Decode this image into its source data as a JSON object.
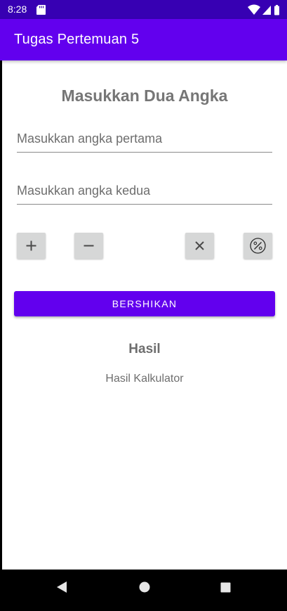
{
  "status_bar": {
    "time": "8:28",
    "icons": [
      "sd-card-icon",
      "wifi-icon",
      "signal-icon",
      "battery-icon"
    ]
  },
  "app_bar": {
    "title": "Tugas Pertemuan 5"
  },
  "form": {
    "heading": "Masukkan Dua Angka",
    "first_number_placeholder": "Masukkan angka pertama",
    "first_number_value": "",
    "second_number_placeholder": "Masukkan angka kedua",
    "second_number_value": ""
  },
  "operations": [
    {
      "name": "add",
      "icon": "plus-icon"
    },
    {
      "name": "subtract",
      "icon": "minus-icon"
    },
    {
      "name": "multiply",
      "icon": "multiply-icon"
    },
    {
      "name": "divide",
      "icon": "percent-icon"
    }
  ],
  "clear_button": {
    "label": "BERSHIKAN"
  },
  "result": {
    "title": "Hasil",
    "value": "Hasil Kalkulator"
  },
  "nav_bar": {
    "icons": [
      "back-icon",
      "home-icon",
      "recents-icon"
    ]
  },
  "colors": {
    "status_bar": "#3700b3",
    "app_bar": "#6200ee",
    "accent": "#6200ee",
    "op_button": "#d6d7d7",
    "heading_text": "#767676"
  }
}
